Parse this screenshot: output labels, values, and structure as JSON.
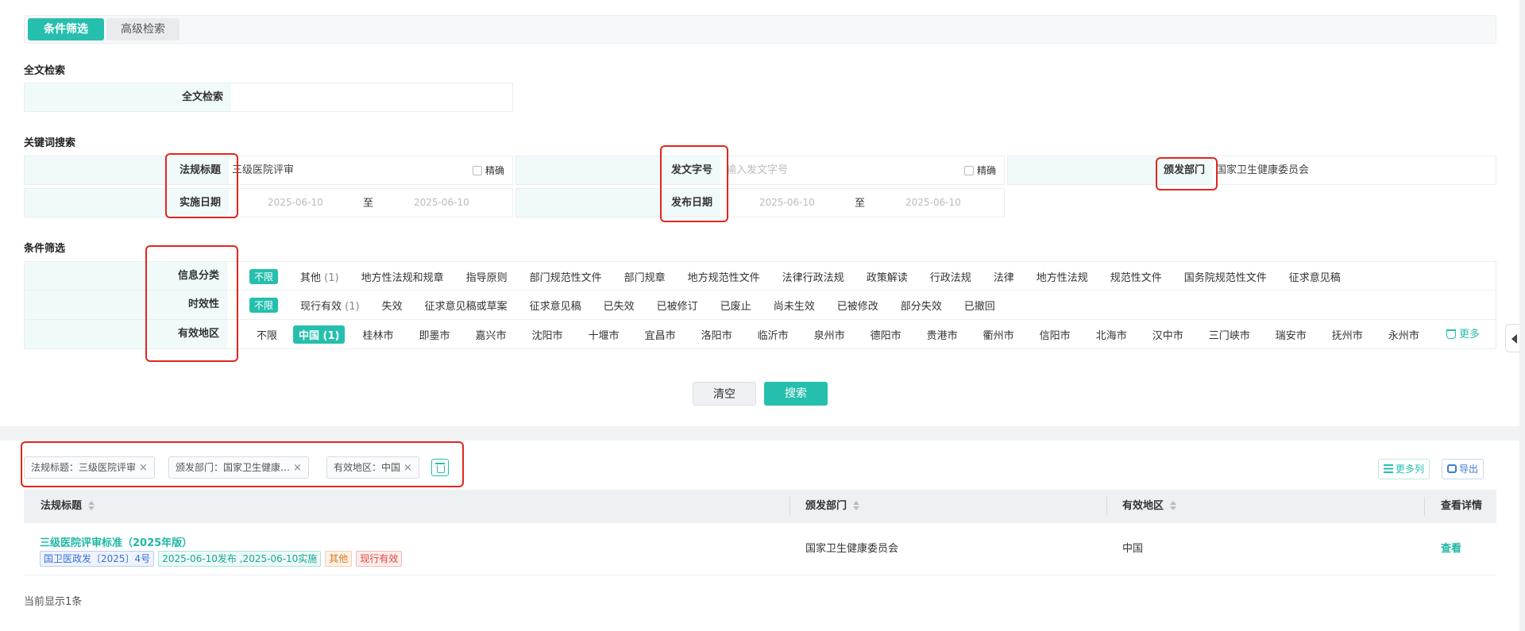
{
  "tabs": {
    "condition": "条件筛选",
    "advanced": "高级检索"
  },
  "fulltext": {
    "section": "全文检索",
    "label": "全文检索",
    "value": ""
  },
  "keyword": {
    "section": "关键词搜索",
    "title_label": "法规标题",
    "title_value": "三级医院评审",
    "exact": "精确",
    "docno_label": "发文字号",
    "docno_placeholder": "输入发文字号",
    "dept_label": "颁发部门",
    "dept_value": "国家卫生健康委员会",
    "impl_label": "实施日期",
    "impl_from": "2025-06-10",
    "impl_to": "2025-06-10",
    "pub_label": "发布日期",
    "pub_from": "2025-06-10",
    "pub_to": "2025-06-10",
    "to": "至"
  },
  "filters": {
    "section": "条件筛选",
    "category": {
      "label": "信息分类",
      "selected": "不限",
      "options": [
        "其他",
        "地方性法规和规章",
        "指导原则",
        "部门规范性文件",
        "部门规章",
        "地方规范性文件",
        "法律行政法规",
        "政策解读",
        "行政法规",
        "法律",
        "地方性法规",
        "规范性文件",
        "国务院规范性文件",
        "征求意见稿"
      ],
      "other_count": "(1)"
    },
    "validity": {
      "label": "时效性",
      "selected": "不限",
      "options": [
        "现行有效",
        "失效",
        "征求意见稿或草案",
        "征求意见稿",
        "已失效",
        "已被修订",
        "已废止",
        "尚未生效",
        "已被修改",
        "部分失效",
        "已撤回"
      ],
      "current_count": "(1)"
    },
    "region": {
      "label": "有效地区",
      "unlimited": "不限",
      "selected": "中国 (1)",
      "options": [
        "桂林市",
        "即墨市",
        "嘉兴市",
        "沈阳市",
        "十堰市",
        "宜昌市",
        "洛阳市",
        "临沂市",
        "泉州市",
        "德阳市",
        "贵港市",
        "衢州市",
        "信阳市",
        "北海市",
        "汉中市",
        "三门峡市",
        "瑞安市",
        "抚州市",
        "永州市"
      ],
      "more": "更多"
    }
  },
  "buttons": {
    "clear": "清空",
    "search": "搜索"
  },
  "chips": [
    "法规标题：三级医院评审",
    "颁发部门：国家卫生健康…",
    "有效地区：中国"
  ],
  "tools": {
    "more_cols": "更多列",
    "export": "导出"
  },
  "table": {
    "headers": {
      "title": "法规标题",
      "dept": "颁发部门",
      "region": "有效地区",
      "detail": "查看详情"
    },
    "rows": [
      {
        "title": "三级医院评审标准（2025年版）",
        "docno": "国卫医政发〔2025〕4号",
        "dates": "2025-06-10发布 ,2025-06-10实施",
        "category": "其他",
        "status": "现行有效",
        "dept": "国家卫生健康委员会",
        "region": "中国",
        "view": "查看"
      }
    ]
  },
  "footer": {
    "count": "当前显示1条"
  }
}
